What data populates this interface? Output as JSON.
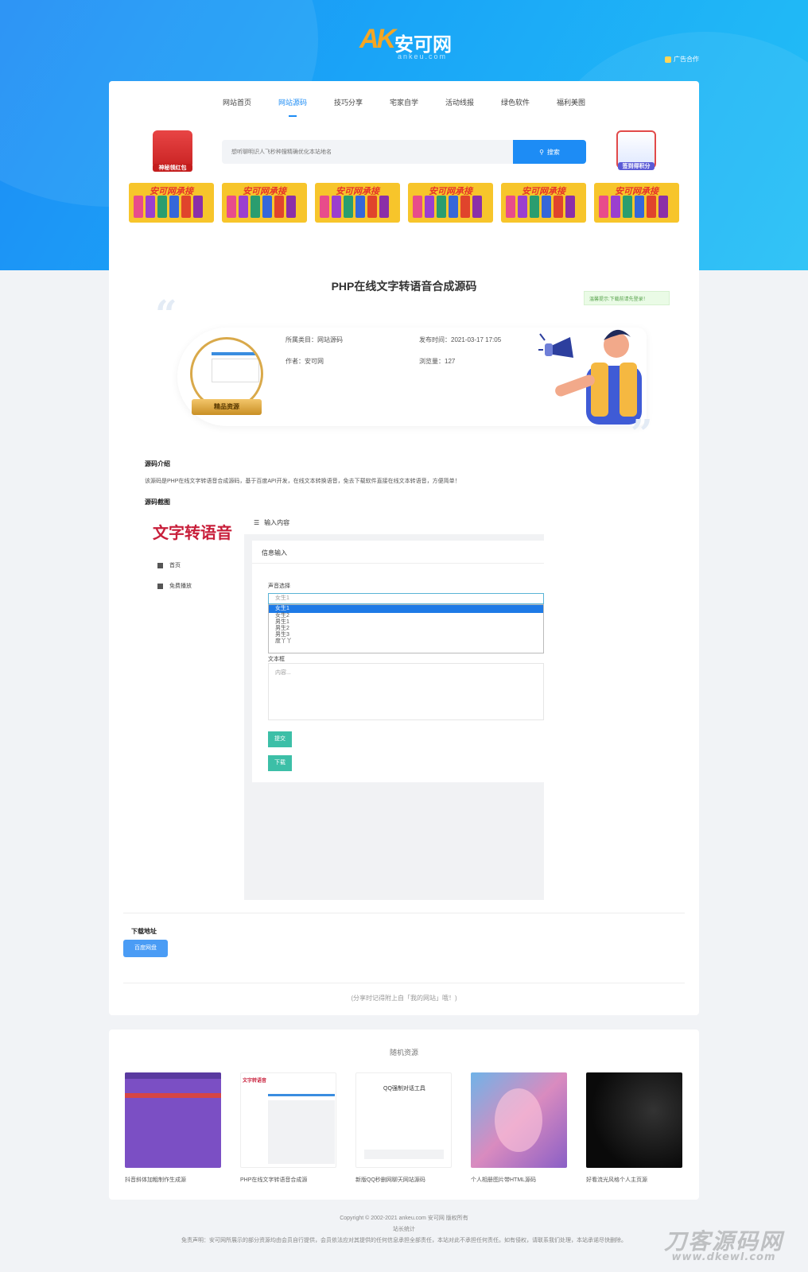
{
  "header": {
    "logo_text": "安可网",
    "logo_sub": "ankeu.com",
    "ad_link": "广告合作"
  },
  "nav": {
    "items": [
      "网站首页",
      "网站源码",
      "技巧分享",
      "宅家自学",
      "活动线报",
      "绿色软件",
      "福利美图"
    ],
    "active_index": 1
  },
  "promo": {
    "left_label": "神秘领红包",
    "right_label": "签到得积分"
  },
  "search": {
    "placeholder": "想听聊明识人飞秒种搜精确优化本站地名",
    "button_label": "搜索"
  },
  "banners": {
    "title": "安可网承接",
    "count": 6
  },
  "post": {
    "title": "PHP在线文字转语音合成源码",
    "notice": "温馨提示:下载前请先登录！",
    "ribbon": "精品资源",
    "category": "所属类目：网站源码",
    "publish_time": "发布时间：2021-03-17 17:05",
    "author": "作者：安可网",
    "views": "浏览量：127"
  },
  "content": {
    "intro_heading": "源码介绍",
    "intro_text": "该源码是PHP在线文字转语音合成源码，基于百度API开发，在线文本转换语音，免去下载软件直接在线文本转语音，方便简单！",
    "shots_heading": "源码截图"
  },
  "screenshot": {
    "logo": "文字转语音",
    "menu": [
      "首页",
      "免费播放"
    ],
    "topbar": "输入内容",
    "form_heading": "信息输入",
    "voice_label": "声音选择",
    "select_value": "女生1",
    "options": [
      "女生1",
      "女生2",
      "男生1",
      "男生2",
      "男生3",
      "度丫丫"
    ],
    "text_label": "文本框",
    "text_placeholder": "内容...",
    "submit_label": "提交",
    "download_label": "下载"
  },
  "download": {
    "heading": "下载地址",
    "button_label": "百度网盘",
    "share_note": "(分享时记得附上自「我的网站」哦！)"
  },
  "random": {
    "heading": "随机资源",
    "items": [
      {
        "caption": "抖音斜体加粗制作生成源"
      },
      {
        "caption": "PHP在线文字转语音合成源"
      },
      {
        "caption": "新版QQ秒删网聊天网站源码"
      },
      {
        "caption": "个人相册图片带HTML源码"
      },
      {
        "caption": "好看流光风格个人主页源"
      }
    ],
    "item3_title": "QQ强制对话工具"
  },
  "footer": {
    "copyright": "Copyright © 2002-2021 ankeu.com 安可网 版权所有",
    "sitemap": "站长统计",
    "disclaimer": "免责声明：安可网所展示的部分资源均由会员自行提供，会员依法应对其提供的任何信息承担全部责任，本站对此不承担任何责任。如有侵权，请联系我们处理，本站承诺尽快删除。"
  },
  "watermark": {
    "line1": "刀客源码网",
    "line2": "www.dkewl.com"
  },
  "colors": {
    "brand_blue": "#1d8cf5",
    "accent_teal": "#3cbfa7"
  }
}
